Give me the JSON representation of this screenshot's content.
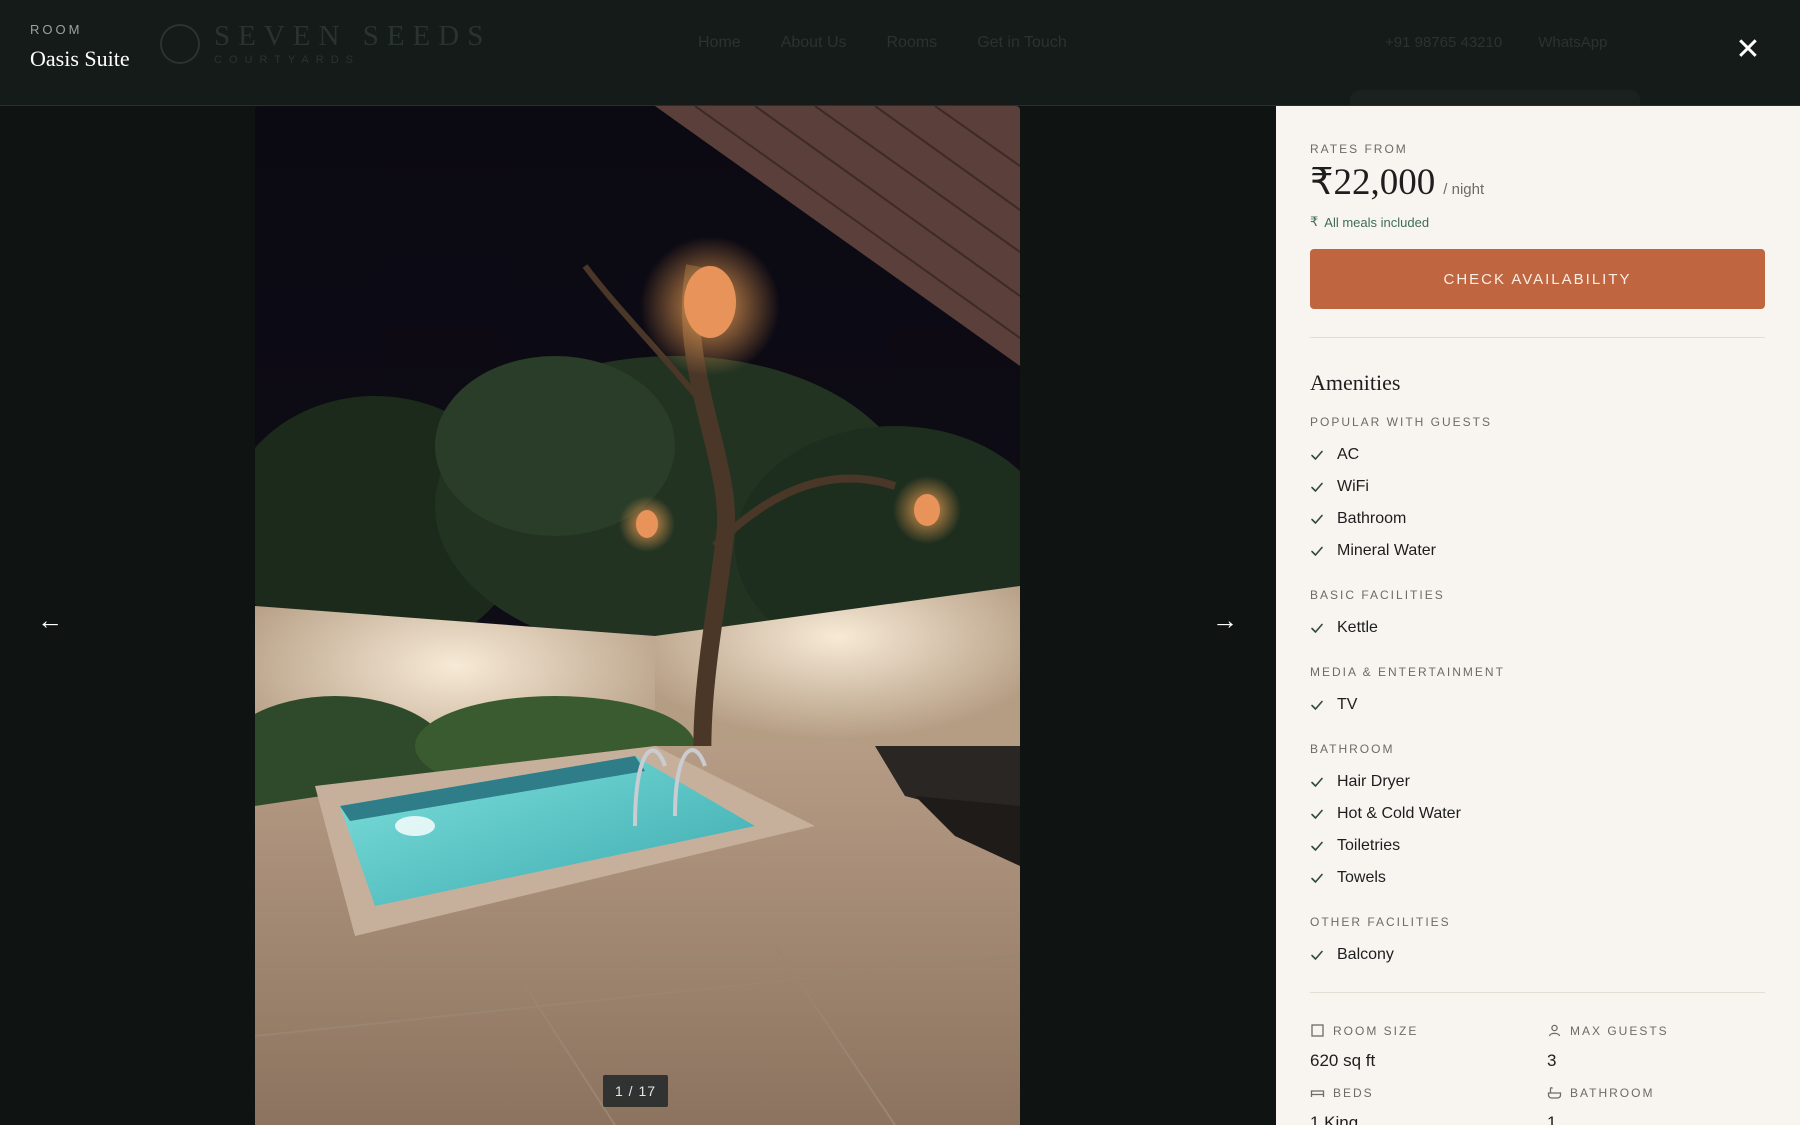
{
  "site_header": {
    "logo_word": "SEVEN SEEDS",
    "logo_sub": "COURTYARDS",
    "nav": [
      "Home",
      "About Us",
      "Rooms",
      "Get in Touch"
    ],
    "contact": [
      "+91 98765 43210",
      "WhatsApp"
    ]
  },
  "overlay": {
    "eyebrow": "ROOM",
    "room_name": "Oasis Suite",
    "close_label": "✕"
  },
  "gallery": {
    "prev_label": "←",
    "next_label": "→",
    "counter": "1 / 17"
  },
  "panel": {
    "rates_label": "RATES FROM",
    "price": "₹22,000",
    "per_night": "/ night",
    "meals_icon": "₹",
    "meals": "All meals included",
    "cta": "CHECK AVAILABILITY",
    "amenities_title": "Amenities",
    "groups": [
      {
        "label": "POPULAR WITH GUESTS",
        "items": [
          "AC",
          "WiFi",
          "Bathroom",
          "Mineral Water"
        ]
      },
      {
        "label": "BASIC FACILITIES",
        "items": [
          "Kettle"
        ]
      },
      {
        "label": "MEDIA & ENTERTAINMENT",
        "items": [
          "TV"
        ]
      },
      {
        "label": "BATHROOM",
        "items": [
          "Hair Dryer",
          "Hot & Cold Water",
          "Toiletries",
          "Towels"
        ]
      },
      {
        "label": "OTHER FACILITIES",
        "items": [
          "Balcony"
        ]
      }
    ],
    "stats": [
      {
        "icon": "square-icon",
        "label": "ROOM SIZE",
        "value": "620 sq ft"
      },
      {
        "icon": "person-icon",
        "label": "MAX GUESTS",
        "value": "3"
      },
      {
        "icon": "bed-icon",
        "label": "BEDS",
        "value": "1 King"
      },
      {
        "icon": "bathtub-icon",
        "label": "BATHROOM",
        "value": "1"
      }
    ]
  },
  "colors": {
    "accent": "#bf6640",
    "meals_green": "#3e6c5b",
    "panel_bg": "#f8f5f0",
    "overlay_bg": "#0f1412"
  }
}
